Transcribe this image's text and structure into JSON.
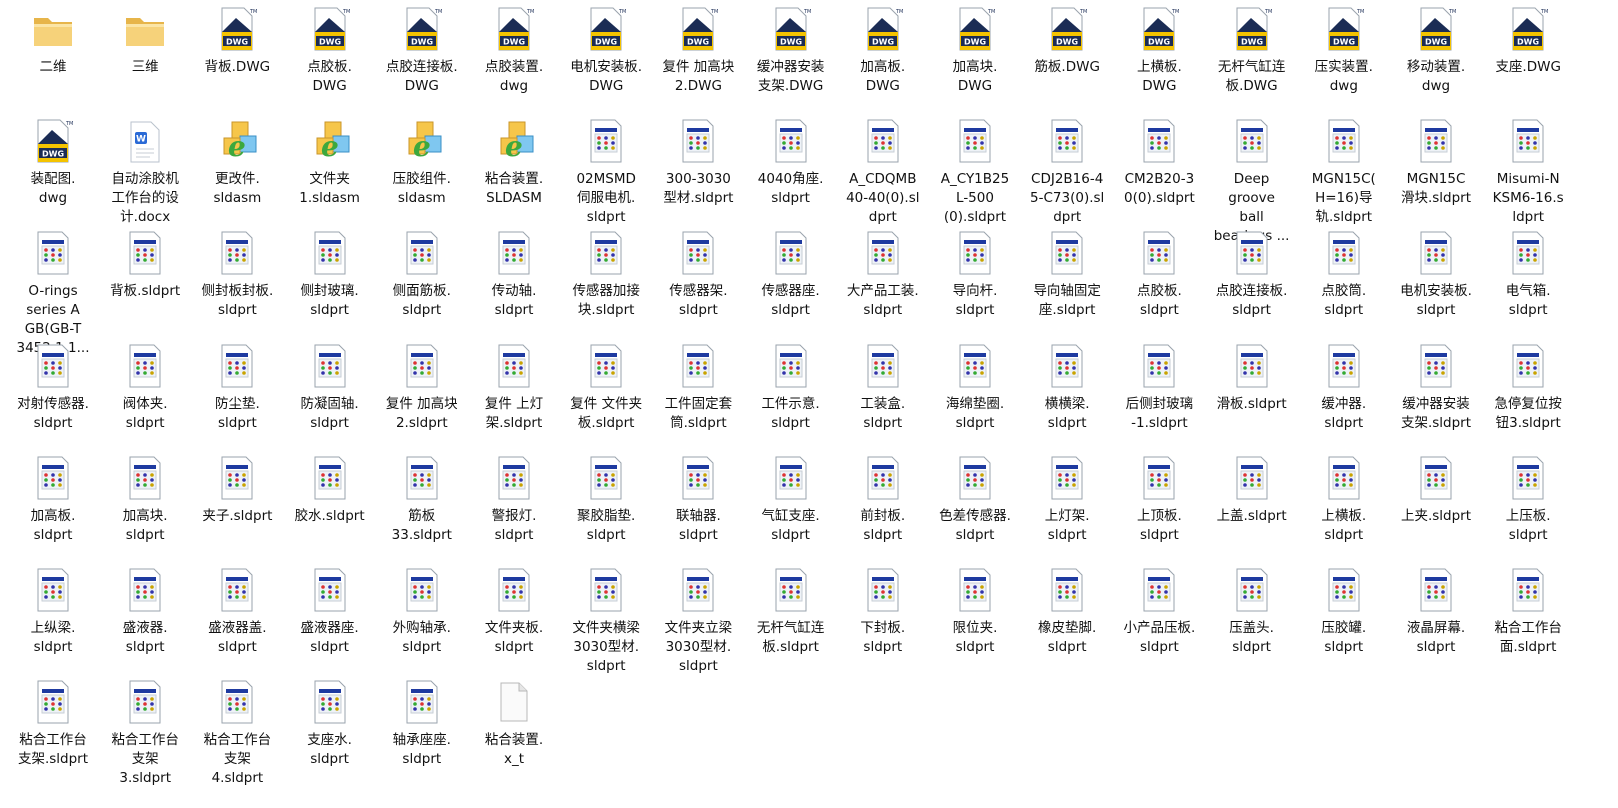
{
  "files": [
    {
      "label": "二维",
      "type": "folder"
    },
    {
      "label": "三维",
      "type": "folder"
    },
    {
      "label": "背板.DWG",
      "type": "dwg"
    },
    {
      "label": "点胶板.\nDWG",
      "type": "dwg"
    },
    {
      "label": "点胶连接板.\nDWG",
      "type": "dwg"
    },
    {
      "label": "点胶装置.\ndwg",
      "type": "dwg"
    },
    {
      "label": "电机安装板.\nDWG",
      "type": "dwg"
    },
    {
      "label": "复件 加高块\n2.DWG",
      "type": "dwg"
    },
    {
      "label": "缓冲器安装\n支架.DWG",
      "type": "dwg"
    },
    {
      "label": "加高板.\nDWG",
      "type": "dwg"
    },
    {
      "label": "加高块.\nDWG",
      "type": "dwg"
    },
    {
      "label": "筋板.DWG",
      "type": "dwg"
    },
    {
      "label": "上横板.\nDWG",
      "type": "dwg"
    },
    {
      "label": "无杆气缸连\n板.DWG",
      "type": "dwg"
    },
    {
      "label": "压实装置.\ndwg",
      "type": "dwg"
    },
    {
      "label": "移动装置.\ndwg",
      "type": "dwg"
    },
    {
      "label": "支座.DWG",
      "type": "dwg"
    },
    {
      "label": "装配图.\ndwg",
      "type": "dwg"
    },
    {
      "label": "自动涂胶机\n工作台的设\n计.docx",
      "type": "docx"
    },
    {
      "label": "更改件.\nsldasm",
      "type": "asm"
    },
    {
      "label": "文件夹\n1.sldasm",
      "type": "asm"
    },
    {
      "label": "压胶组件.\nsldasm",
      "type": "asm"
    },
    {
      "label": "粘合装置.\nSLDASM",
      "type": "asm"
    },
    {
      "label": "02MSMD\n伺服电机.\nsldprt",
      "type": "prt"
    },
    {
      "label": "300-3030\n型材.sldprt",
      "type": "prt"
    },
    {
      "label": "4040角座.\nsldprt",
      "type": "prt"
    },
    {
      "label": "A_CDQMB\n40-40(0).sl\ndprt",
      "type": "prt"
    },
    {
      "label": "A_CY1B25\nL-500\n(0).sldprt",
      "type": "prt"
    },
    {
      "label": "CDJ2B16-4\n5-C73(0).sl\ndprt",
      "type": "prt"
    },
    {
      "label": "CM2B20-3\n0(0).sldprt",
      "type": "prt"
    },
    {
      "label": "Deep\ngroove\nball\nbearings ...",
      "type": "prt"
    },
    {
      "label": "MGN15C(\nH=16)导\n轨.sldprt",
      "type": "prt"
    },
    {
      "label": "MGN15C\n滑块.sldprt",
      "type": "prt"
    },
    {
      "label": "Misumi-N\nKSM6-16.s\nldprt",
      "type": "prt"
    },
    {
      "label": "O-rings\nseries A\nGB(GB-T\n3452.1 1...",
      "type": "prt"
    },
    {
      "label": "背板.sldprt",
      "type": "prt"
    },
    {
      "label": "侧封板封板.\nsldprt",
      "type": "prt"
    },
    {
      "label": "侧封玻璃.\nsldprt",
      "type": "prt"
    },
    {
      "label": "侧面筋板.\nsldprt",
      "type": "prt"
    },
    {
      "label": "传动轴.\nsldprt",
      "type": "prt"
    },
    {
      "label": "传感器加接\n块.sldprt",
      "type": "prt"
    },
    {
      "label": "传感器架.\nsldprt",
      "type": "prt"
    },
    {
      "label": "传感器座.\nsldprt",
      "type": "prt"
    },
    {
      "label": "大产品工装.\nsldprt",
      "type": "prt"
    },
    {
      "label": "导向杆.\nsldprt",
      "type": "prt"
    },
    {
      "label": "导向轴固定\n座.sldprt",
      "type": "prt"
    },
    {
      "label": "点胶板.\nsldprt",
      "type": "prt"
    },
    {
      "label": "点胶连接板.\nsldprt",
      "type": "prt"
    },
    {
      "label": "点胶筒.\nsldprt",
      "type": "prt"
    },
    {
      "label": "电机安装板.\nsldprt",
      "type": "prt"
    },
    {
      "label": "电气箱.\nsldprt",
      "type": "prt"
    },
    {
      "label": "对射传感器.\nsldprt",
      "type": "prt"
    },
    {
      "label": "阀体夹.\nsldprt",
      "type": "prt"
    },
    {
      "label": "防尘垫.\nsldprt",
      "type": "prt"
    },
    {
      "label": "防凝固轴.\nsldprt",
      "type": "prt"
    },
    {
      "label": "复件 加高块\n2.sldprt",
      "type": "prt"
    },
    {
      "label": "复件 上灯\n架.sldprt",
      "type": "prt"
    },
    {
      "label": "复件 文件夹\n板.sldprt",
      "type": "prt"
    },
    {
      "label": "工件固定套\n筒.sldprt",
      "type": "prt"
    },
    {
      "label": "工件示意.\nsldprt",
      "type": "prt"
    },
    {
      "label": "工装盒.\nsldprt",
      "type": "prt"
    },
    {
      "label": "海绵垫圈.\nsldprt",
      "type": "prt"
    },
    {
      "label": "横横梁.\nsldprt",
      "type": "prt"
    },
    {
      "label": "后侧封玻璃\n-1.sldprt",
      "type": "prt"
    },
    {
      "label": "滑板.sldprt",
      "type": "prt"
    },
    {
      "label": "缓冲器.\nsldprt",
      "type": "prt"
    },
    {
      "label": "缓冲器安装\n支架.sldprt",
      "type": "prt"
    },
    {
      "label": "急停复位按\n钮3.sldprt",
      "type": "prt"
    },
    {
      "label": "加高板.\nsldprt",
      "type": "prt"
    },
    {
      "label": "加高块.\nsldprt",
      "type": "prt"
    },
    {
      "label": "夹子.sldprt",
      "type": "prt"
    },
    {
      "label": "胶水.sldprt",
      "type": "prt"
    },
    {
      "label": "筋板\n33.sldprt",
      "type": "prt"
    },
    {
      "label": "警报灯.\nsldprt",
      "type": "prt"
    },
    {
      "label": "聚胶脂垫.\nsldprt",
      "type": "prt"
    },
    {
      "label": "联轴器.\nsldprt",
      "type": "prt"
    },
    {
      "label": "气缸支座.\nsldprt",
      "type": "prt"
    },
    {
      "label": "前封板.\nsldprt",
      "type": "prt"
    },
    {
      "label": "色差传感器.\nsldprt",
      "type": "prt"
    },
    {
      "label": "上灯架.\nsldprt",
      "type": "prt"
    },
    {
      "label": "上顶板.\nsldprt",
      "type": "prt"
    },
    {
      "label": "上盖.sldprt",
      "type": "prt"
    },
    {
      "label": "上横板.\nsldprt",
      "type": "prt"
    },
    {
      "label": "上夹.sldprt",
      "type": "prt"
    },
    {
      "label": "上压板.\nsldprt",
      "type": "prt"
    },
    {
      "label": "上纵梁.\nsldprt",
      "type": "prt"
    },
    {
      "label": "盛液器.\nsldprt",
      "type": "prt"
    },
    {
      "label": "盛液器盖.\nsldprt",
      "type": "prt"
    },
    {
      "label": "盛液器座.\nsldprt",
      "type": "prt"
    },
    {
      "label": "外购轴承.\nsldprt",
      "type": "prt"
    },
    {
      "label": "文件夹板.\nsldprt",
      "type": "prt"
    },
    {
      "label": "文件夹横梁\n3030型材.\nsldprt",
      "type": "prt"
    },
    {
      "label": "文件夹立梁\n3030型材.\nsldprt",
      "type": "prt"
    },
    {
      "label": "无杆气缸连\n板.sldprt",
      "type": "prt"
    },
    {
      "label": "下封板.\nsldprt",
      "type": "prt"
    },
    {
      "label": "限位夹.\nsldprt",
      "type": "prt"
    },
    {
      "label": "橡皮垫脚.\nsldprt",
      "type": "prt"
    },
    {
      "label": "小产品压板.\nsldprt",
      "type": "prt"
    },
    {
      "label": "压盖头.\nsldprt",
      "type": "prt"
    },
    {
      "label": "压胶罐.\nsldprt",
      "type": "prt"
    },
    {
      "label": "液晶屏幕.\nsldprt",
      "type": "prt"
    },
    {
      "label": "粘合工作台\n面.sldprt",
      "type": "prt"
    },
    {
      "label": "粘合工作台\n支架.sldprt",
      "type": "prt"
    },
    {
      "label": "粘合工作台\n支架\n3.sldprt",
      "type": "prt"
    },
    {
      "label": "粘合工作台\n支架\n4.sldprt",
      "type": "prt"
    },
    {
      "label": "支座水.\nsldprt",
      "type": "prt"
    },
    {
      "label": "轴承座座.\nsldprt",
      "type": "prt"
    },
    {
      "label": "粘合装置.\nx_t",
      "type": "blank"
    }
  ],
  "badges": {
    "dwg": "DWG",
    "docx": "W",
    "asm": "e"
  },
  "colors": {
    "folder": "#f2c65b",
    "dwg_yellow": "#f4c300",
    "asm_green": "#3da83d"
  }
}
